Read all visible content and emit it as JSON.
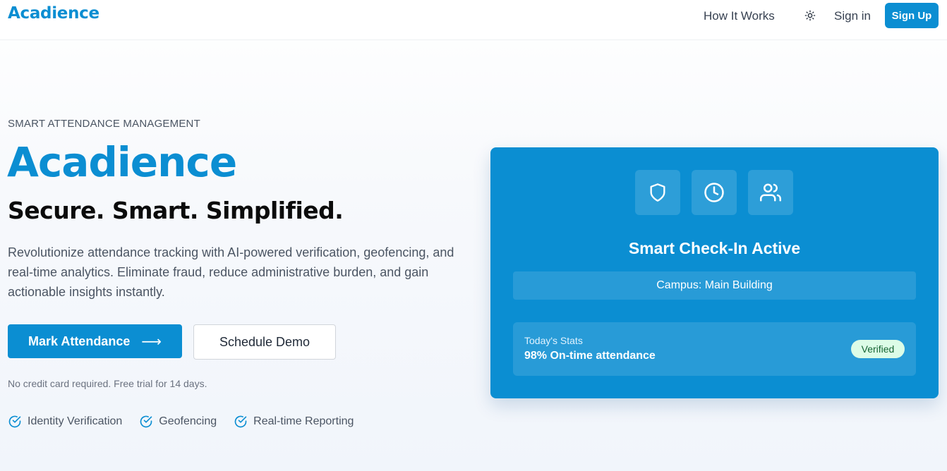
{
  "nav": {
    "logo": "Acadience",
    "how_it_works": "How It Works",
    "theme_toggle_icon": "sun-icon",
    "sign_in": "Sign in",
    "sign_up": "Sign Up"
  },
  "hero": {
    "eyebrow": "SMART ATTENDANCE MANAGEMENT",
    "title": "Acadience",
    "subtitle": "Secure. Smart. Simplified.",
    "description": "Revolutionize attendance tracking with AI-powered verification, geofencing, and real-time analytics. Eliminate fraud, reduce administrative burden, and gain actionable insights instantly.",
    "primary_button": "Mark Attendance",
    "primary_button_icon": "arrow-right-icon",
    "secondary_button": "Schedule Demo",
    "note": "No credit card required. Free trial for 14 days.",
    "features": [
      {
        "label": "Identity Verification",
        "icon": "check-circle-icon"
      },
      {
        "label": "Geofencing",
        "icon": "check-circle-icon"
      },
      {
        "label": "Real-time Reporting",
        "icon": "check-circle-icon"
      }
    ]
  },
  "card": {
    "icons": [
      "shield-icon",
      "clock-icon",
      "users-icon"
    ],
    "title": "Smart Check-In Active",
    "campus": "Campus: Main Building",
    "stats_label": "Today's Stats",
    "stats_value": "98% On-time attendance",
    "badge": "Verified"
  },
  "colors": {
    "brand": "#0b8ed2",
    "badge_bg": "#dcfce7",
    "badge_text": "#166534"
  }
}
